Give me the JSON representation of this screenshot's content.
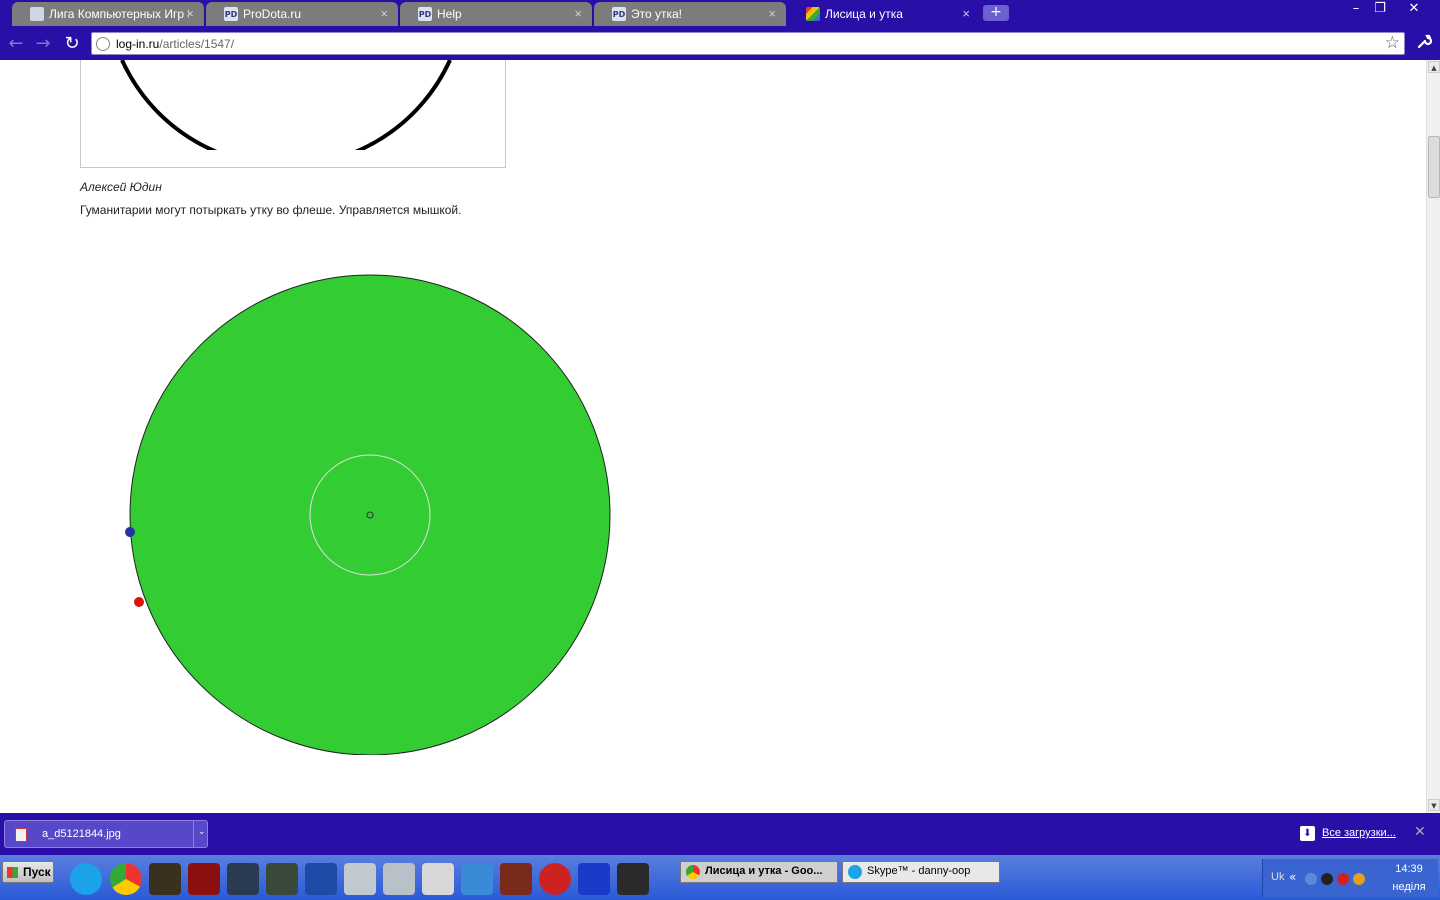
{
  "browser": {
    "tabs": [
      {
        "title": "Лига Компьютерных Игр I...",
        "active": false,
        "favicon": "lki-icon"
      },
      {
        "title": "ProDota.ru",
        "active": false,
        "favicon": "pd-icon"
      },
      {
        "title": "Help",
        "active": false,
        "favicon": "pd-icon"
      },
      {
        "title": "Это утка!",
        "active": false,
        "favicon": "pd-icon"
      },
      {
        "title": "Лисица и утка",
        "active": true,
        "favicon": "duck-icon"
      }
    ],
    "tab_close": "×",
    "new_tab": "+",
    "window_controls": {
      "minimize": "–",
      "restore": "❐",
      "close": "✕"
    },
    "nav": {
      "back": "←",
      "forward": "→",
      "reload": "↻"
    },
    "url": {
      "host": "log-in.ru",
      "path": "/articles/1547/"
    },
    "star": "☆",
    "wrench": "🔧",
    "accent_color": "#2a0ea8"
  },
  "article": {
    "author": "Алексей Юдин",
    "description": "Гуманитарии могут потыркать утку во флеше. Управляется мышкой.",
    "game": {
      "pond_color": "#33cc33",
      "duck_color": "#2233aa",
      "fox_color": "#dd1111"
    }
  },
  "scrollbar": {
    "up": "▲",
    "down": "▼"
  },
  "downloads": {
    "file": "a_d5121844.jpg",
    "dropdown": "⌄",
    "all_downloads": "Все загрузки...",
    "close": "✕"
  },
  "taskbar": {
    "start": "Пуск",
    "buttons": [
      {
        "label": "Лисица и утка - Goo...",
        "active": true
      },
      {
        "label": "Skype™ - danny-oop",
        "active": false
      }
    ],
    "tray": {
      "lang": "Uk",
      "chevron": "«",
      "time": "14:39",
      "day": "неділя"
    }
  }
}
